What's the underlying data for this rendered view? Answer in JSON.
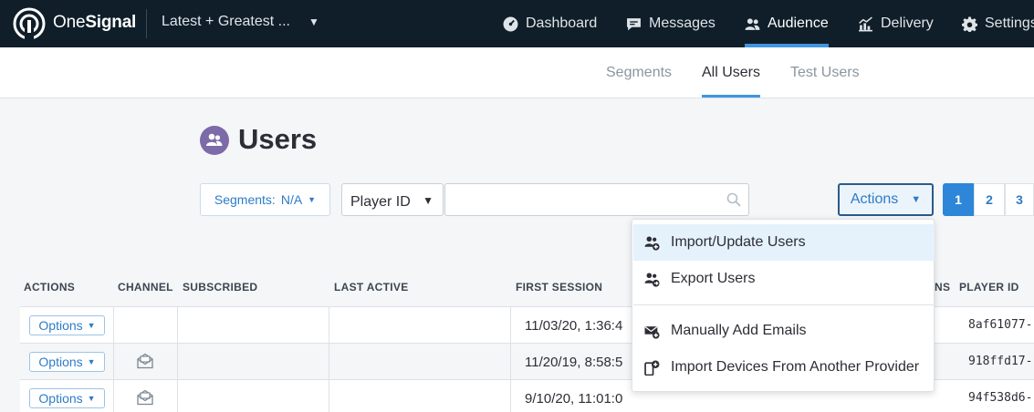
{
  "nav": {
    "brand_one": "One",
    "brand_two": "Signal",
    "app_name": "Latest + Greatest ...",
    "items": [
      {
        "label": "Dashboard",
        "icon": "dashboard-icon"
      },
      {
        "label": "Messages",
        "icon": "message-icon"
      },
      {
        "label": "Audience",
        "icon": "audience-icon",
        "active": true
      },
      {
        "label": "Delivery",
        "icon": "delivery-icon"
      },
      {
        "label": "Settings",
        "icon": "gear-icon"
      }
    ]
  },
  "subnav": {
    "tabs": [
      "Segments",
      "All Users",
      "Test Users"
    ],
    "active": "All Users"
  },
  "page": {
    "title": "Users"
  },
  "toolbar": {
    "segments_label": "Segments:",
    "segments_value": "N/A",
    "id_select": "Player ID",
    "search_value": "",
    "actions_label": "Actions",
    "pages": [
      "1",
      "2",
      "3"
    ],
    "current_page": "1"
  },
  "table": {
    "headers": [
      "ACTIONS",
      "CHANNEL",
      "SUBSCRIBED",
      "LAST ACTIVE",
      "FIRST SESSION",
      "NS",
      "PLAYER ID"
    ],
    "option_label": "Options",
    "rows": [
      {
        "channel": "",
        "first_session": "11/03/20, 1:36:4",
        "player_id": "8af61077-"
      },
      {
        "channel": "email",
        "first_session": "11/20/19, 8:58:5",
        "player_id": "918ffd17-"
      },
      {
        "channel": "email",
        "first_session": "9/10/20, 11:01:0",
        "player_id": "94f538d6-"
      }
    ]
  },
  "menu": {
    "items": [
      {
        "label": "Import/Update Users",
        "icon": "users-import-icon"
      },
      {
        "label": "Export Users",
        "icon": "users-export-icon"
      },
      {
        "label": "Manually Add Emails",
        "icon": "email-add-icon"
      },
      {
        "label": "Import Devices From Another Provider",
        "icon": "device-import-icon"
      }
    ]
  },
  "colors": {
    "accent": "#3f95e1",
    "nav_bg": "#0f1e29",
    "users_icon": "#7d6aa8"
  }
}
